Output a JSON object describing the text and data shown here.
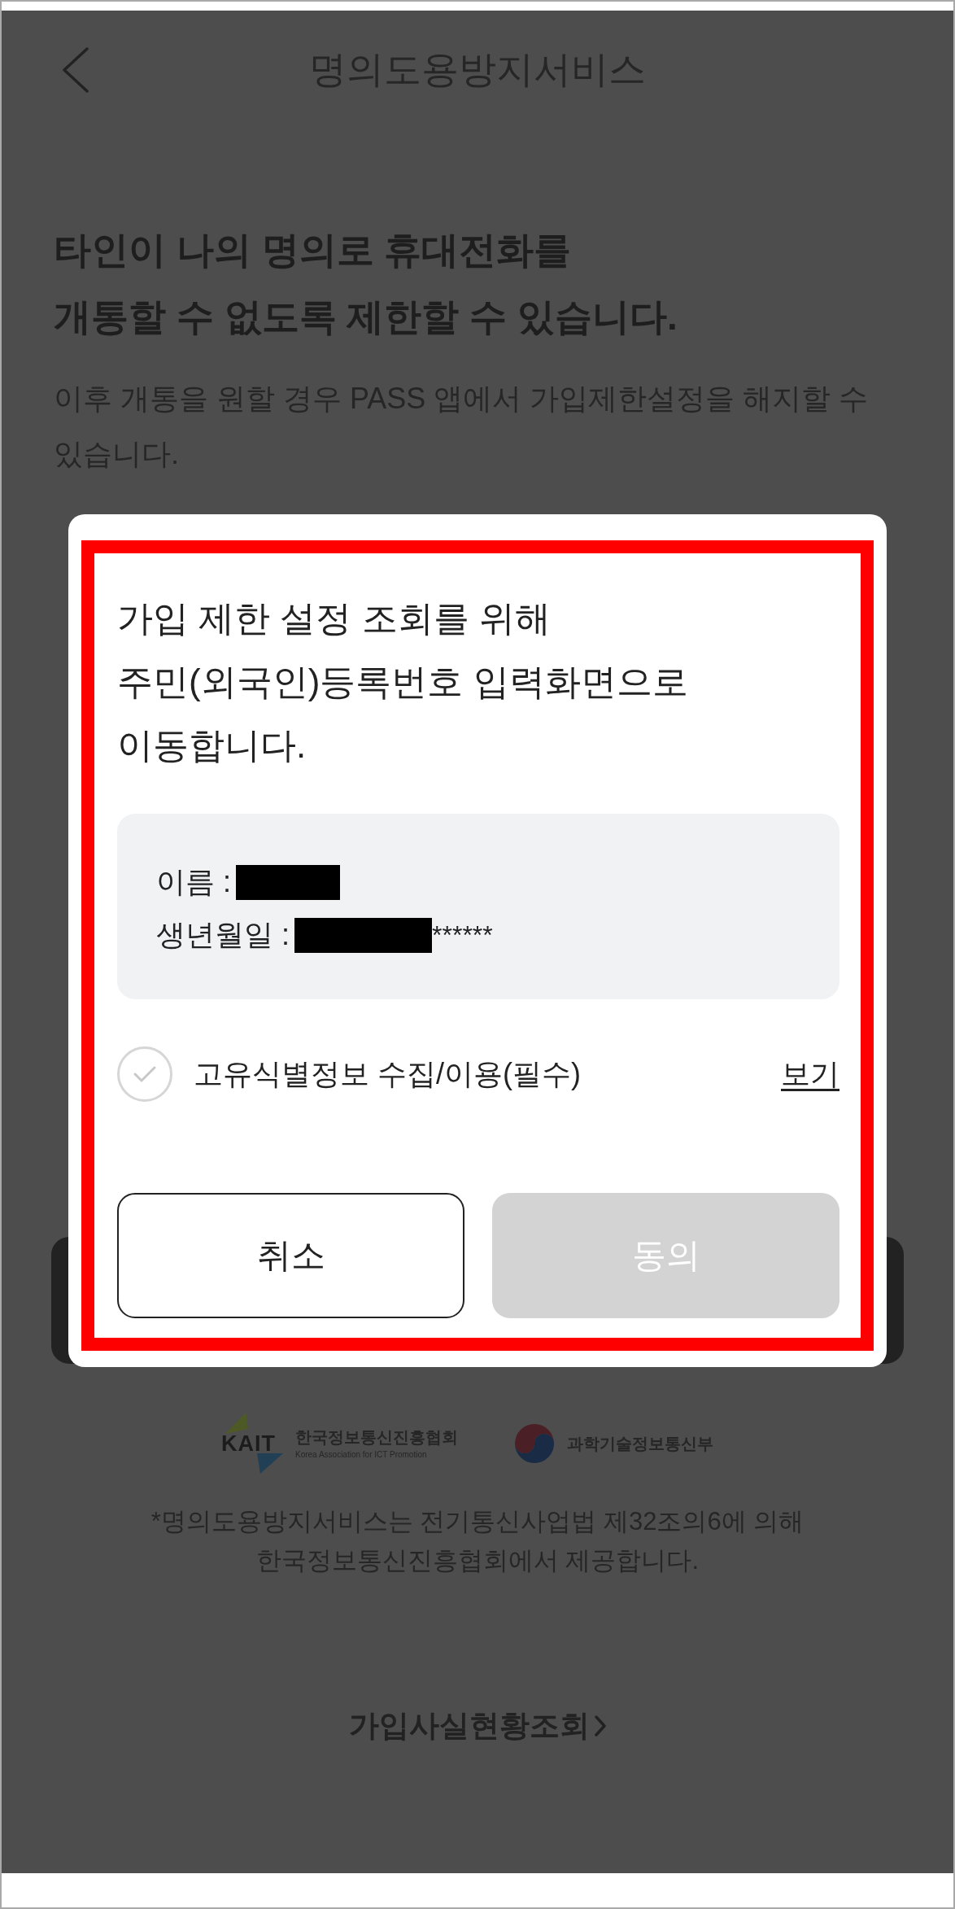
{
  "header": {
    "title": "명의도용방지서비스"
  },
  "intro": {
    "headline": "타인이 나의 명의로 휴대전화를\n개통할 수 없도록 제한할 수 있습니다.",
    "description": "이후 개통을 원할 경우 PASS 앱에서 가입제한설정을 해지할 수 있습니다."
  },
  "dialog": {
    "message": "가입 제한 설정 조회를 위해\n주민(외국인)등록번호 입력화면으로\n이동합니다.",
    "info_rows": [
      {
        "kind": "name",
        "label": "이름 :",
        "redacted": true
      },
      {
        "kind": "birthdate",
        "label": "생년월일 :",
        "redacted": true,
        "suffix": "******"
      }
    ],
    "consent": {
      "label": "고유식별정보 수집/이용(필수)",
      "checked": false,
      "link": "보기"
    },
    "buttons": [
      {
        "kind": "outline",
        "label": "취소",
        "disabled": false
      },
      {
        "kind": "filled",
        "label": "동의",
        "disabled": true
      }
    ]
  },
  "footer": {
    "logos": [
      {
        "kind": "kait",
        "mark": "KAIT",
        "name": "한국정보통신진흥협회",
        "subtitle": "Korea Association for ICT Promotion"
      },
      {
        "kind": "emblem",
        "name": "과학기술정보통신부"
      }
    ],
    "notice": "*명의도용방지서비스는 전기통신사업법 제32조의6에 의해\n한국정보통신진흥협회에서 제공합니다.",
    "link": "가입사실현황조회"
  }
}
